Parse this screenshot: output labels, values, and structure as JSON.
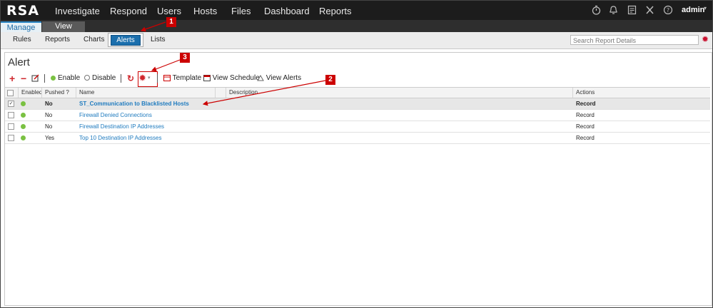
{
  "topnav": {
    "logo": "RSA",
    "items": [
      "Investigate",
      "Respond",
      "Users",
      "Hosts",
      "Files",
      "Dashboard",
      "Reports"
    ],
    "user": "admin"
  },
  "tabs": {
    "manage": "Manage",
    "view": "View"
  },
  "subnav": {
    "rules": "Rules",
    "reports": "Reports",
    "charts": "Charts",
    "alerts": "Alerts",
    "lists": "Lists"
  },
  "search": {
    "placeholder": "Search Report Details"
  },
  "panel": {
    "title": "Alert"
  },
  "toolbar": {
    "enable": "Enable",
    "disable": "Disable",
    "template": "Template",
    "view_schedule": "View Schedule",
    "view_alerts": "View Alerts"
  },
  "table": {
    "headers": {
      "enabled": "Enabled",
      "pushed": "Pushed ?",
      "name": "Name",
      "description": "Description",
      "actions": "Actions"
    },
    "rows": [
      {
        "pushed": "No",
        "name": "ST_Communication to Blacklisted Hosts",
        "actions": "Record"
      },
      {
        "pushed": "No",
        "name": "Firewall Denied Connections",
        "actions": "Record"
      },
      {
        "pushed": "No",
        "name": "Firewall Destination IP Addresses",
        "actions": "Record"
      },
      {
        "pushed": "Yes",
        "name": "Top 10 Destination IP Addresses",
        "actions": "Record"
      }
    ]
  },
  "callouts": [
    "1",
    "2",
    "3"
  ],
  "colors": {
    "accent": "#1b6fad",
    "callout": "#cc0000",
    "enabled_dot": "#7ac142"
  }
}
